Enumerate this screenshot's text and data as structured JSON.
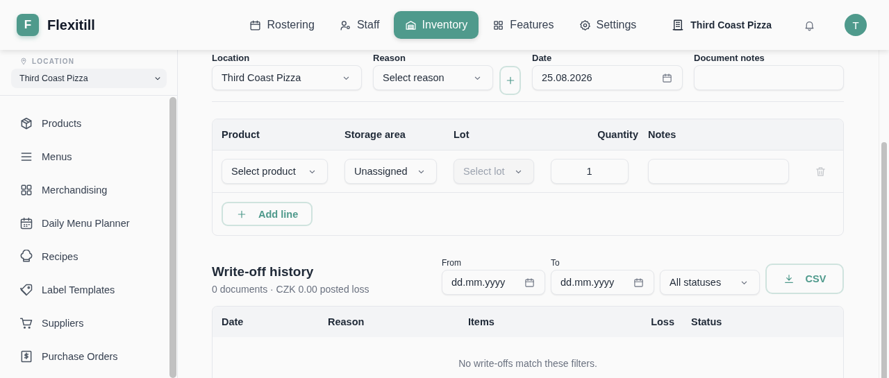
{
  "app": {
    "logo_letter": "F",
    "name": "Flexitill"
  },
  "nav": [
    {
      "label": "Rostering",
      "selected": false
    },
    {
      "label": "Staff",
      "selected": false
    },
    {
      "label": "Inventory",
      "selected": true
    },
    {
      "label": "Features",
      "selected": false
    },
    {
      "label": "Settings",
      "selected": false
    }
  ],
  "location_chip": "Third Coast Pizza",
  "avatar": "T",
  "sidebar": {
    "location_label": "LOCATION",
    "location_value": "Third Coast Pizza",
    "items": [
      {
        "label": "Products"
      },
      {
        "label": "Menus"
      },
      {
        "label": "Merchandising"
      },
      {
        "label": "Daily Menu Planner"
      },
      {
        "label": "Recipes"
      },
      {
        "label": "Label Templates"
      },
      {
        "label": "Suppliers"
      },
      {
        "label": "Purchase Orders"
      }
    ]
  },
  "form": {
    "location": {
      "label": "Location",
      "value": "Third Coast Pizza"
    },
    "reason": {
      "label": "Reason",
      "value": "Select reason"
    },
    "date": {
      "label": "Date",
      "value": "25.08.2026"
    },
    "document_notes": {
      "label": "Document notes"
    }
  },
  "lines": {
    "columns": [
      {
        "label": "Product"
      },
      {
        "label": "Storage area"
      },
      {
        "label": "Lot"
      },
      {
        "label": "Quantity"
      },
      {
        "label": "Notes"
      }
    ],
    "rows": [
      {
        "product": "Select product",
        "storage_area": "Unassigned",
        "lot": {
          "value": "Select lot",
          "disabled": true
        },
        "quantity": "1"
      }
    ],
    "add_button": "Add line"
  },
  "history": {
    "title": "Write-off history",
    "summary": "0 documents · CZK 0.00 posted loss",
    "from": {
      "label": "From",
      "placeholder": "dd.mm.yyyy"
    },
    "to": {
      "label": "To",
      "placeholder": "dd.mm.yyyy"
    },
    "status_filter": "All statuses",
    "export_button": "CSV",
    "columns": [
      {
        "label": "Date"
      },
      {
        "label": "Reason"
      },
      {
        "label": "Items"
      },
      {
        "label": "Loss"
      },
      {
        "label": "Status"
      }
    ],
    "empty_text": "No write-offs match these filters."
  }
}
